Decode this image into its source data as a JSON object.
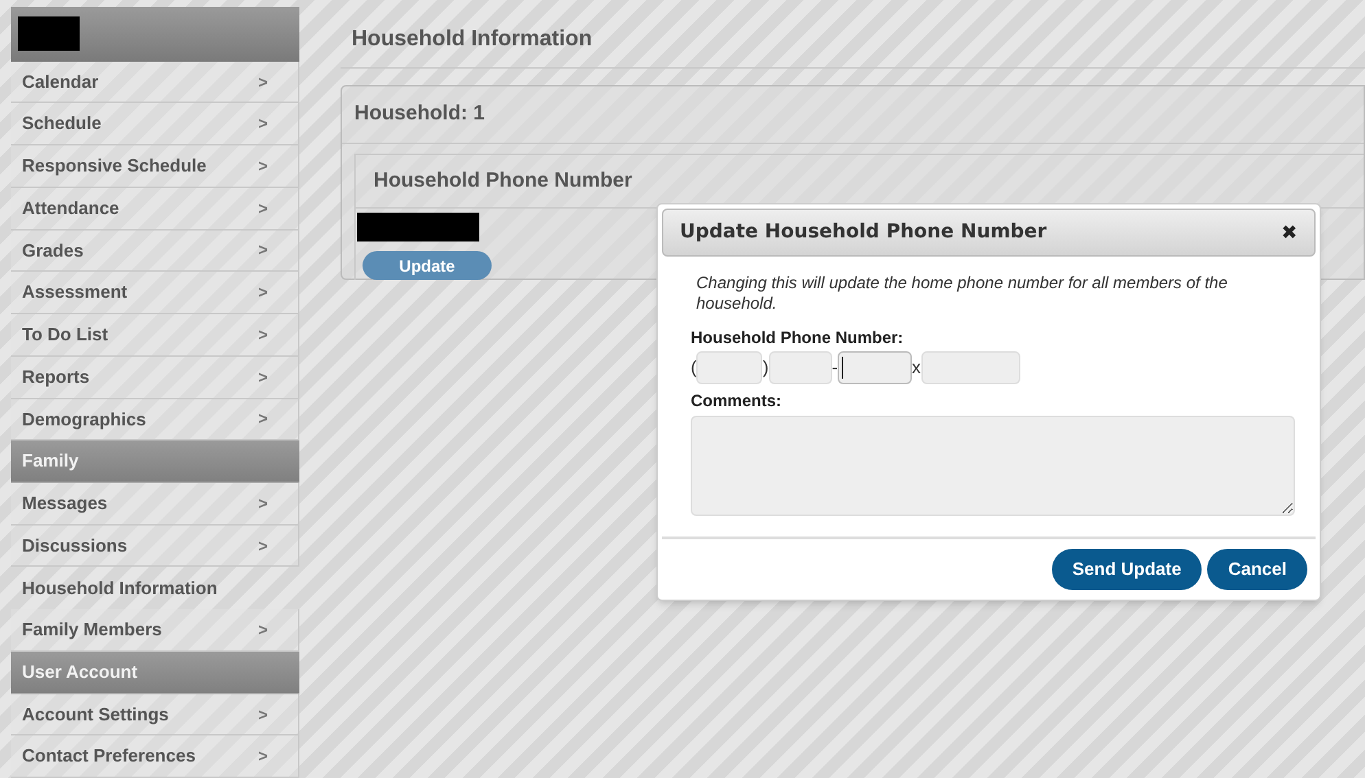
{
  "sidebar": {
    "items": [
      {
        "kind": "link",
        "label": "Calendar",
        "selected": false
      },
      {
        "kind": "link",
        "label": "Schedule",
        "selected": false
      },
      {
        "kind": "link",
        "label": "Responsive Schedule",
        "selected": false
      },
      {
        "kind": "link",
        "label": "Attendance",
        "selected": false
      },
      {
        "kind": "link",
        "label": "Grades",
        "selected": false
      },
      {
        "kind": "link",
        "label": "Assessment",
        "selected": false
      },
      {
        "kind": "link",
        "label": "To Do List",
        "selected": false
      },
      {
        "kind": "link",
        "label": "Reports",
        "selected": false
      },
      {
        "kind": "link",
        "label": "Demographics",
        "selected": false
      },
      {
        "kind": "section",
        "label": "Family"
      },
      {
        "kind": "link",
        "label": "Messages",
        "selected": false
      },
      {
        "kind": "link",
        "label": "Discussions",
        "selected": false
      },
      {
        "kind": "link",
        "label": "Household Information",
        "selected": true
      },
      {
        "kind": "link",
        "label": "Family Members",
        "selected": false
      },
      {
        "kind": "section",
        "label": "User Account"
      },
      {
        "kind": "link",
        "label": "Account Settings",
        "selected": false
      },
      {
        "kind": "link",
        "label": "Contact Preferences",
        "selected": false
      }
    ],
    "chevron": ">"
  },
  "page": {
    "title": "Household Information",
    "household": {
      "title": "Household: 1",
      "section_title": "Household Phone Number",
      "button": "Update"
    }
  },
  "dialog": {
    "title": "Update Household Phone Number",
    "close": "✖",
    "note": "Changing this will update the home phone number for all members of the household.",
    "phone_label": "Household Phone Number:",
    "phone_parts": [
      {
        "kind": "text",
        "text": "("
      },
      {
        "kind": "input",
        "focused": false
      },
      {
        "kind": "text",
        "text": ")"
      },
      {
        "kind": "input",
        "focused": false
      },
      {
        "kind": "text",
        "text": "-"
      },
      {
        "kind": "input",
        "focused": true
      },
      {
        "kind": "text",
        "text": "x"
      },
      {
        "kind": "input",
        "focused": false
      }
    ],
    "comments_label": "Comments:",
    "buttons": [
      "Send Update",
      "Cancel"
    ]
  }
}
